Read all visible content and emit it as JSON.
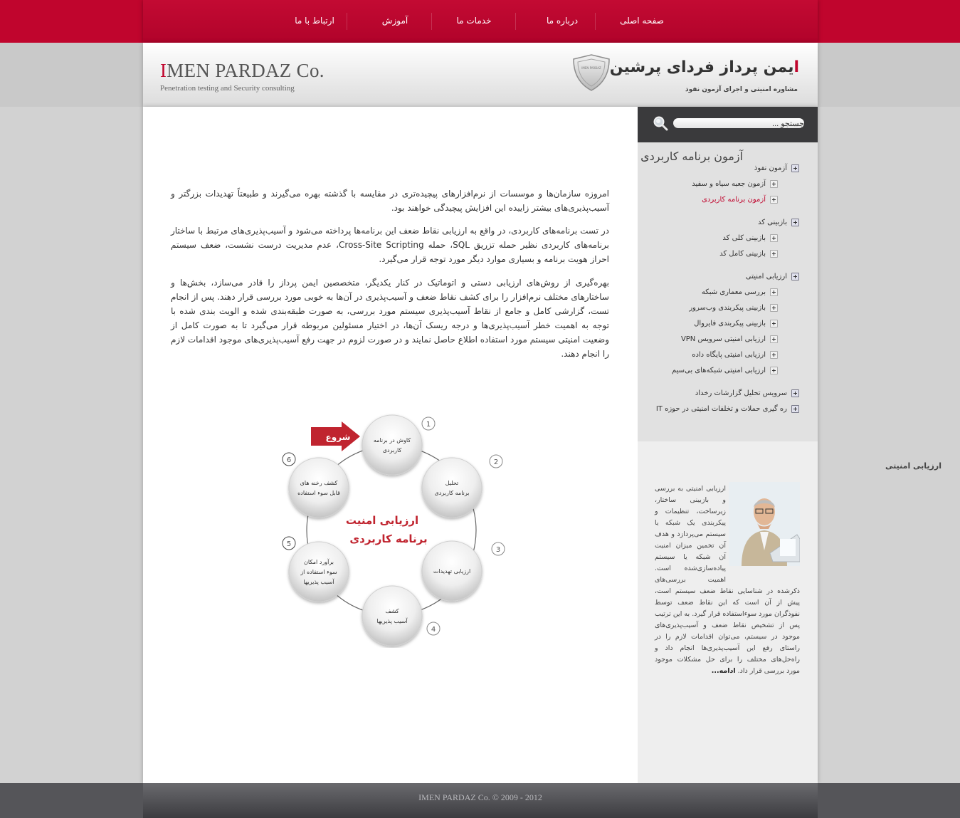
{
  "nav": {
    "items": [
      "صفحه اصلی",
      "درباره ما",
      "خدمات ما",
      "آموزش",
      "ارتباط با ما"
    ]
  },
  "header": {
    "brand_en_first": "I",
    "brand_en_rest": "MEN PARDAZ Co.",
    "brand_en_sub": "Penetration testing and Security consulting",
    "brand_fa_first": "ا",
    "brand_fa_rest": "یمن پرداز فردای پرشین",
    "brand_fa_sub": "مشاوره امنیتی و اجرای آزمون نفوذ",
    "shield_label": "IMEN PARDAZ"
  },
  "search": {
    "value": "جستجو ..."
  },
  "menu": {
    "items": [
      {
        "label": "آزمون نفوذ",
        "level": 0,
        "active": false
      },
      {
        "label": "آزمون جعبه سیاه و سفید",
        "level": 1,
        "active": false
      },
      {
        "label": "آزمون برنامه کاربردی",
        "level": 1,
        "active": true
      },
      {
        "label": "بازبینی کد",
        "level": 0,
        "active": false
      },
      {
        "label": "بازبینی کلی کد",
        "level": 1,
        "active": false
      },
      {
        "label": "بازبینی کامل کد",
        "level": 1,
        "active": false
      },
      {
        "label": "ارزیابی امنیتی",
        "level": 0,
        "active": false
      },
      {
        "label": "بررسی معماری شبکه",
        "level": 1,
        "active": false
      },
      {
        "label": "بازبینی پیکربندی وب‌سرور",
        "level": 1,
        "active": false
      },
      {
        "label": "بازبینی پیکربندی فایروال",
        "level": 1,
        "active": false
      },
      {
        "label": "ارزیابی امنیتی سرویس VPN",
        "level": 1,
        "active": false
      },
      {
        "label": "ارزیابی امنیتی پایگاه داده",
        "level": 1,
        "active": false
      },
      {
        "label": "ارزیابی امنیتی شبکه‌های بی‌سیم",
        "level": 1,
        "active": false
      },
      {
        "label": "سرویس تحلیل گزارشات رخداد",
        "level": 0,
        "active": false
      },
      {
        "label": "ره گیری حملات و تخلفات امنیتی در حوزه IT",
        "level": 0,
        "active": false
      }
    ]
  },
  "article": {
    "title": "آزمون برنامه کاربردی",
    "p1": "امروزه سازمان‌ها و موسسات از نرم‌افزارهای پیچیده‌تری در مقایسه با گذشته بهره می‌گیرند و طبیعتاً تهدیدات بزرگتر و آسیب‌پذیری‌های بیشتر زاییده این افزایش پیچیدگی خواهند بود.",
    "p2": "در تست برنامه‌های کاربردی، در واقع به ارزیابی نقاط ضعف این برنامه‌ها پرداخته می‌شود و آسیب‌پذیری‌های مرتبط با ساختار برنامه‌های کاربردی نظیر حمله تزریق SQL، حمله Cross-Site Scripting، عدم مدیریت درست نشست، ضعف سیستم احراز هویت برنامه و بسیاری موارد دیگر مورد توجه قرار می‌گیرد.",
    "p3": "بهره‌گیری از روش‌های ارزیابی دستی و اتوماتیک در کنار یکدیگر، متخصصین ایمن پرداز را قادر می‌سازد، بخش‌ها و ساختارهای مختلف نرم‌افزار را برای کشف نقاط ضعف و آسیب‌پذیری در آن‌ها به خوبی مورد بررسی قرار دهند. پس از انجام تست، گزارشی کامل و جامع از نقاط آسیب‌پذیری سیستم مورد بررسی، به صورت طبقه‌بندی شده و الویت بندی شده با توجه به اهمیت خطر آسیب‌پذیری‌ها و درجه ریسک آن‌ها، در اختیار مسئولین مربوطه قرار می‌گیرد تا به صورت کامل از وضعیت امنیتی سیستم مورد استفاده اطلاع حاصل نمایند و در صورت لزوم در جهت رفع آسیب‌پذیری‌های موجود اقدامات لازم را انجام دهند."
  },
  "diagram": {
    "center_line1": "ارزیابی امنیت",
    "center_line2": "برنامه کاربردی",
    "start_label": "شروع",
    "accent_color": "#c0242f",
    "nodes": [
      {
        "num": "1",
        "line1": "کاوش در برنامه",
        "line2": "کاربردی",
        "line3": ""
      },
      {
        "num": "2",
        "line1": "تحلیل",
        "line2": "برنامه کاربردی",
        "line3": ""
      },
      {
        "num": "3",
        "line1": "ارزیابی تهدیدات",
        "line2": "",
        "line3": ""
      },
      {
        "num": "4",
        "line1": "کشف",
        "line2": "آسیب پذیریها",
        "line3": ""
      },
      {
        "num": "5",
        "line1": "برآورد امکان",
        "line2": "سوء استفاده از",
        "line3": "آسیب پذیریها"
      },
      {
        "num": "6",
        "line1": "کشف رخنه های",
        "line2": "قابل سوء استفاده",
        "line3": ""
      }
    ]
  },
  "sidebar_box": {
    "title": "ارزیابی امنیتی",
    "text": "ارزیابی امنیتی به بررسی و بازبینی ساختار، زیرساخت، تنظیمات و پیکربندی یک شبکه یا سیستم می‌پردازد و هدف آن تخمین میزان امنیت آن شبکه یا سیستم پیاده‌سازی‌شده است. اهمیت بررسی‌های ذکرشده در شناسایی نقاط ضعف سیستم است، پیش از آن است که این نقاط ضعف توسط نفوذگران مورد سوءاستفاده قرار گیرد. به این ترتیب پس از تشخیص نقاط ضعف و آسیب‌پذیری‌های موجود در سیستم، می‌توان اقدامات لازم را در راستای رفع این آسیب‌پذیری‌ها انجام داد و راه‌حل‌های مختلف را برای حل مشکلات موجود مورد بررسی قرار داد.",
    "more": "ادامه..."
  },
  "footer": {
    "text": "IMEN PARDAZ Co. © 2009 - 2012"
  },
  "colors": {
    "brand_red": "#c0052d",
    "dark": "#3a3a3c"
  }
}
